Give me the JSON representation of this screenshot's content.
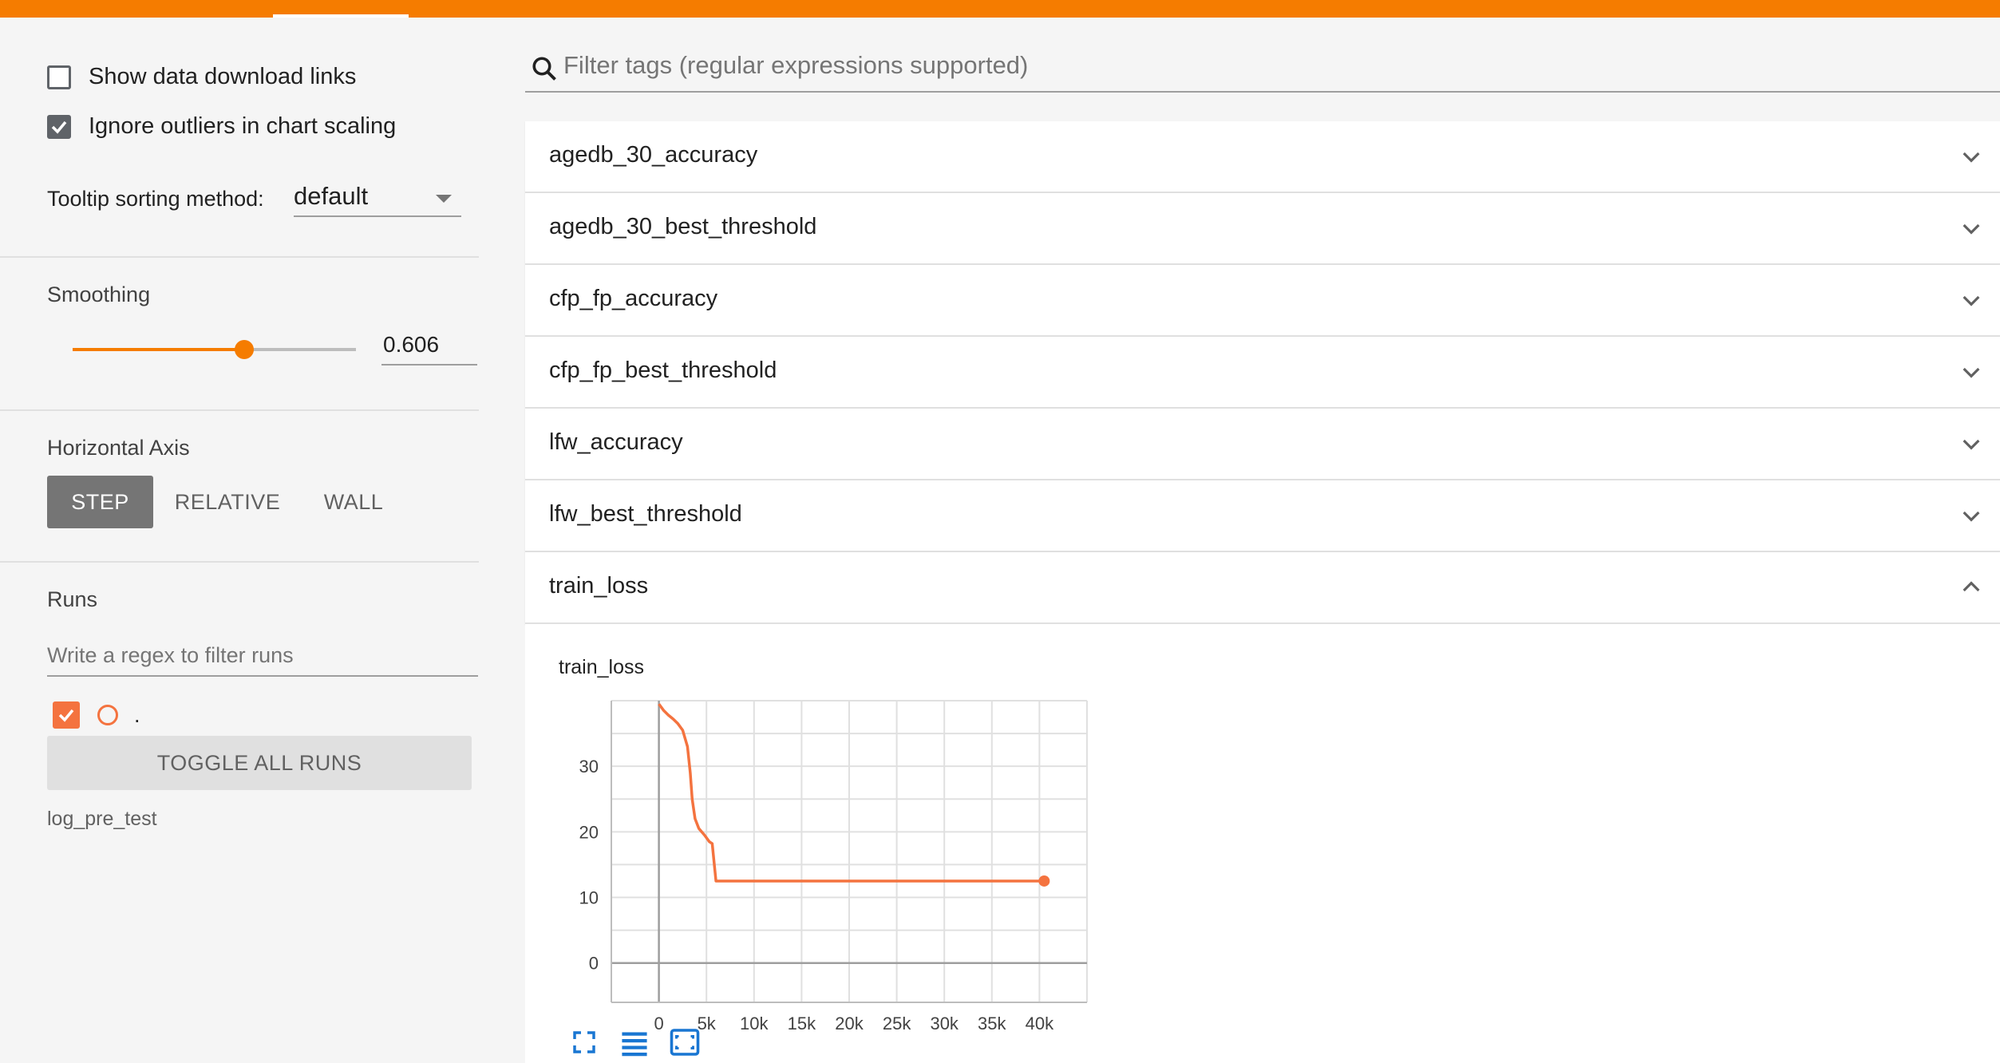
{
  "sidebar": {
    "show_download_links": {
      "label": "Show data download links",
      "checked": false
    },
    "ignore_outliers": {
      "label": "Ignore outliers in chart scaling",
      "checked": true
    },
    "tooltip_sorting": {
      "label": "Tooltip sorting method:",
      "value": "default"
    },
    "smoothing": {
      "title": "Smoothing",
      "value": "0.606",
      "fraction": 0.606
    },
    "horizontal_axis": {
      "title": "Horizontal Axis",
      "options": [
        {
          "label": "STEP",
          "active": true
        },
        {
          "label": "RELATIVE",
          "active": false
        },
        {
          "label": "WALL",
          "active": false
        }
      ]
    },
    "runs": {
      "title": "Runs",
      "filter_placeholder": "Write a regex to filter runs",
      "run_item": {
        "label": ".",
        "checked": true,
        "color": "#f4733f"
      },
      "toggle_all_label": "TOGGLE ALL RUNS",
      "run_group_name": "log_pre_test"
    }
  },
  "main": {
    "search_placeholder": "Filter tags (regular expressions supported)",
    "categories": [
      {
        "name": "agedb_30_accuracy",
        "expanded": false
      },
      {
        "name": "agedb_30_best_threshold",
        "expanded": false
      },
      {
        "name": "cfp_fp_accuracy",
        "expanded": false
      },
      {
        "name": "cfp_fp_best_threshold",
        "expanded": false
      },
      {
        "name": "lfw_accuracy",
        "expanded": false
      },
      {
        "name": "lfw_best_threshold",
        "expanded": false
      },
      {
        "name": "train_loss",
        "expanded": true
      }
    ]
  },
  "colors": {
    "accent": "#f57c00",
    "series": "#f4733f"
  },
  "chart_data": {
    "type": "line",
    "title": "train_loss",
    "xlabel": "",
    "ylabel": "",
    "x_ticks": [
      "0",
      "5k",
      "10k",
      "15k",
      "20k",
      "25k",
      "30k",
      "35k",
      "40k"
    ],
    "y_ticks": [
      "0",
      "10",
      "20",
      "30"
    ],
    "xlim": [
      -5000,
      45000
    ],
    "ylim": [
      -6,
      40
    ],
    "grid": true,
    "series": [
      {
        "points": [
          [
            0,
            39.5
          ],
          [
            500,
            38.5
          ],
          [
            1000,
            37.8
          ],
          [
            1500,
            37.2
          ],
          [
            2000,
            36.5
          ],
          [
            2500,
            35.5
          ],
          [
            3000,
            33
          ],
          [
            3300,
            29
          ],
          [
            3500,
            25
          ],
          [
            3800,
            22
          ],
          [
            4200,
            20.5
          ],
          [
            4800,
            19.5
          ],
          [
            5300,
            18.5
          ],
          [
            5600,
            18.2
          ],
          [
            6000,
            12.5
          ],
          [
            8000,
            12.5
          ],
          [
            12000,
            12.5
          ],
          [
            16000,
            12.5
          ],
          [
            20000,
            12.5
          ],
          [
            24000,
            12.5
          ],
          [
            28000,
            12.5
          ],
          [
            32000,
            12.5
          ],
          [
            36000,
            12.5
          ],
          [
            40500,
            12.5
          ]
        ],
        "end_marker": true
      }
    ]
  }
}
